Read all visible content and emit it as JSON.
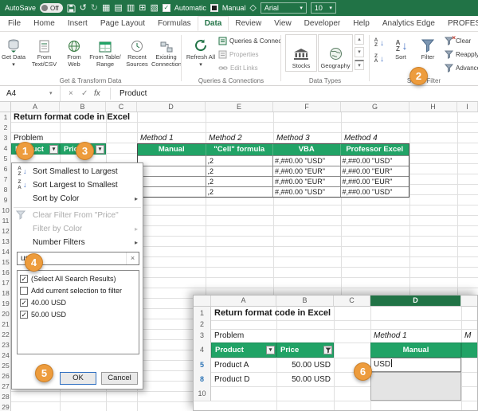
{
  "titlebar": {
    "autosave": "AutoSave",
    "autosave_state": "Off",
    "qat_automatic": "Automatic",
    "qat_manual": "Manual",
    "font_name": "Arial",
    "font_size": "10"
  },
  "tabs": [
    "File",
    "Home",
    "Insert",
    "Page Layout",
    "Formulas",
    "Data",
    "Review",
    "View",
    "Developer",
    "Help",
    "Analytics Edge",
    "PROFESSOR EX"
  ],
  "ribbon": {
    "groups": {
      "get_transform": "Get & Transform Data",
      "queries": "Queries & Connections",
      "data_types": "Data Types",
      "sort_filter": "Sort & Filter"
    },
    "get_data": "Get Data",
    "from_text": "From Text/CSV",
    "from_web": "From Web",
    "from_table": "From Table/ Range",
    "recent_sources": "Recent Sources",
    "existing_connections": "Existing Connections",
    "refresh_all": "Refresh All",
    "queries_connections": "Queries & Connections",
    "properties": "Properties",
    "edit_links": "Edit Links",
    "stocks": "Stocks",
    "geography": "Geography",
    "sort": "Sort",
    "filter": "Filter",
    "clear": "Clear",
    "reapply": "Reapply",
    "advanced": "Advanced"
  },
  "formula_bar": {
    "name_box": "A4",
    "fx": "fx",
    "value": "Product"
  },
  "sheet": {
    "col_headers": [
      "A",
      "B",
      "C",
      "D",
      "E",
      "F",
      "G",
      "H",
      "I"
    ],
    "row_count": 29,
    "title": "Return format code in Excel",
    "problem": "Problem",
    "methods": [
      "Method 1",
      "Method 2",
      "Method 3",
      "Method 4"
    ],
    "product": "Product",
    "price": "Price",
    "headers": [
      "Manual",
      "\"Cell\" formula",
      "VBA",
      "Professor Excel"
    ],
    "rows": [
      {
        "m2": ",2",
        "m3": "#,##0.00 \"USD\"",
        "m4": "#,##0.00 \"USD\""
      },
      {
        "m2": ",2",
        "m3": "#,##0.00 \"EUR\"",
        "m4": "#,##0.00 \"EUR\""
      },
      {
        "m2": ",2",
        "m3": "#,##0.00 \"EUR\"",
        "m4": "#,##0.00 \"EUR\""
      },
      {
        "m2": ",2",
        "m3": "#,##0.00 \"USD\"",
        "m4": "#,##0.00 \"USD\""
      }
    ]
  },
  "filter_menu": {
    "sort_asc": "Sort Smallest to Largest",
    "sort_desc": "Sort Largest to Smallest",
    "sort_color": "Sort by Color",
    "clear_filter": "Clear Filter From \"Price\"",
    "filter_color": "Filter by Color",
    "number_filters": "Number Filters",
    "search_value": "usd",
    "options": [
      {
        "label": "(Select All Search Results)",
        "checked": true
      },
      {
        "label": "Add current selection to filter",
        "checked": false
      },
      {
        "label": "40.00 USD",
        "checked": true
      },
      {
        "label": "50.00 USD",
        "checked": true
      }
    ],
    "ok": "OK",
    "cancel": "Cancel"
  },
  "overlay": {
    "col_headers": [
      "A",
      "B",
      "C",
      "D"
    ],
    "row_numbers": [
      "1",
      "2",
      "3",
      "4",
      "5",
      "8",
      "10"
    ],
    "title": "Return format code in Excel",
    "problem": "Problem",
    "method1": "Method 1",
    "method2_cut": "M",
    "product": "Product",
    "price": "Price",
    "manual": "Manual",
    "rows": [
      {
        "a": "Product A",
        "b": "50.00 USD"
      },
      {
        "a": "Product D",
        "b": "50.00 USD"
      }
    ],
    "typed": "USD"
  },
  "callouts": {
    "c1": "1",
    "c2": "2",
    "c3": "3",
    "c4": "4",
    "c5": "5",
    "c6": "6"
  },
  "colors": {
    "titlebar_green": "#217346",
    "table_header_green": "#21a366",
    "callout_orange": "#ed9c3d",
    "filtered_row_blue": "#2e75b6"
  }
}
